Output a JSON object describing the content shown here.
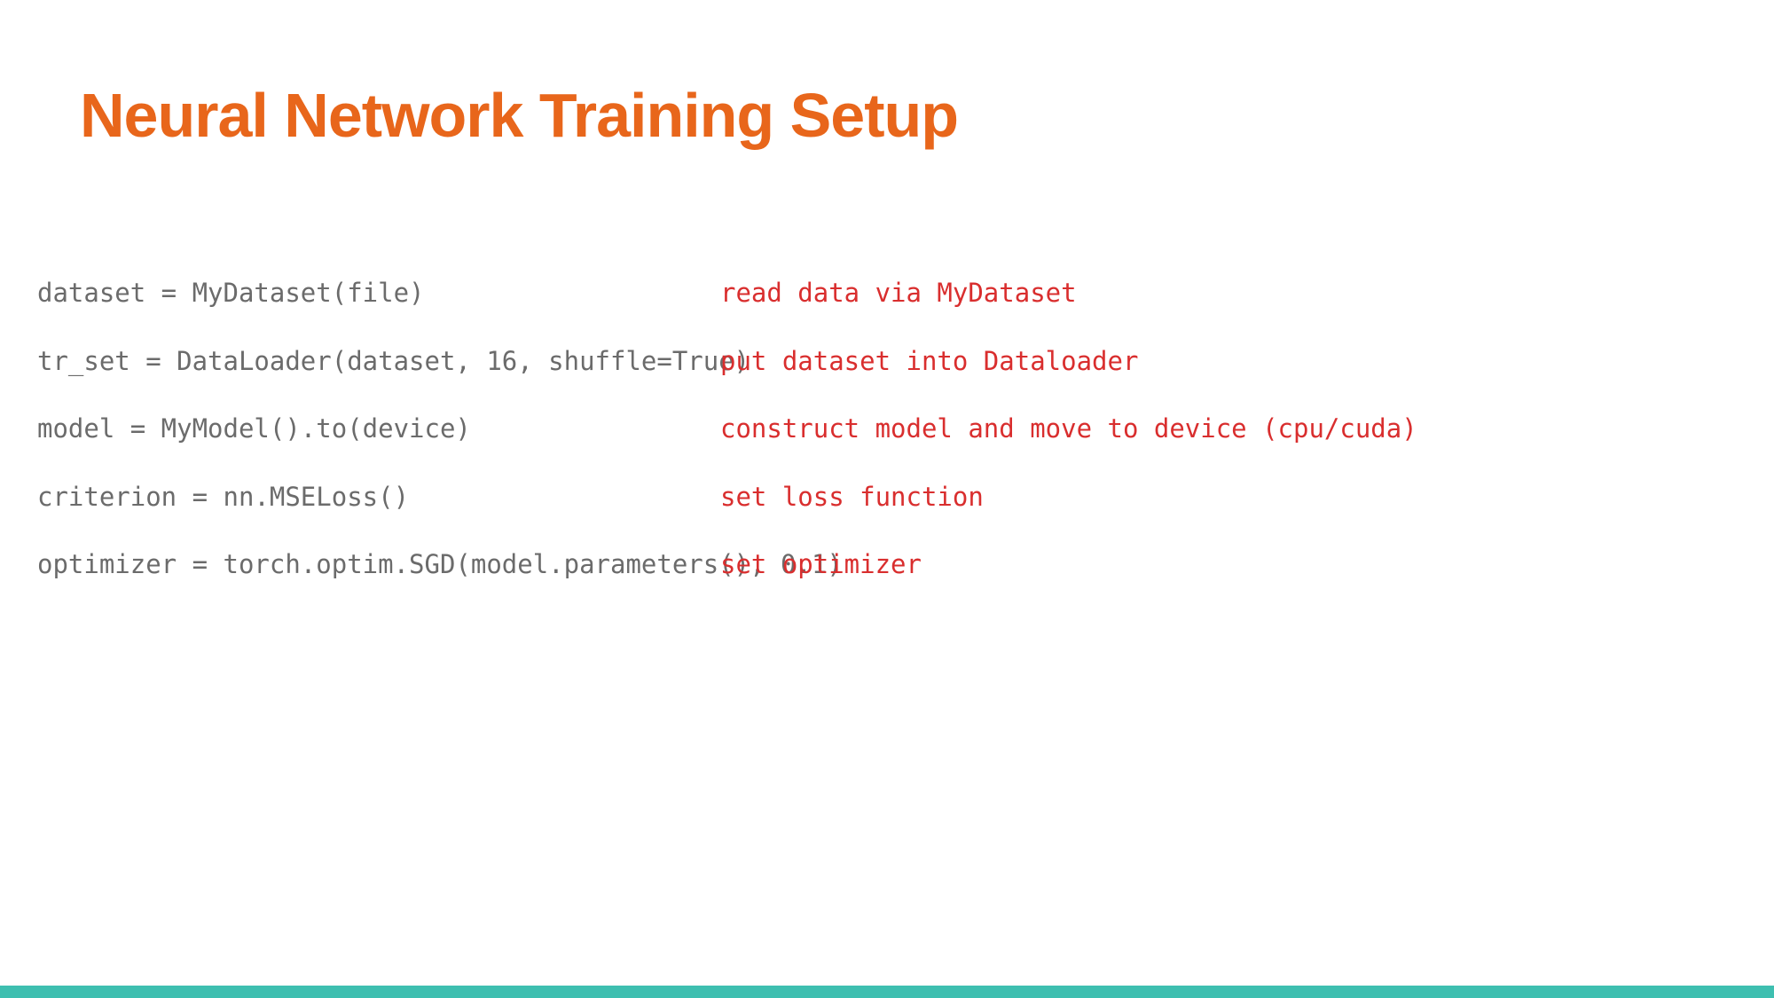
{
  "title": "Neural Network Training Setup",
  "rows": [
    {
      "code": "dataset = MyDataset(file)",
      "comment": "read data via MyDataset"
    },
    {
      "code": "tr_set = DataLoader(dataset, 16, shuffle=True)",
      "comment": "put dataset into Dataloader"
    },
    {
      "code": "model = MyModel().to(device)",
      "comment": "construct model and move to device (cpu/cuda)"
    },
    {
      "code": "criterion = nn.MSELoss()",
      "comment": "set loss function"
    },
    {
      "code": "optimizer = torch.optim.SGD(model.parameters(), 0.1)",
      "comment": "set optimizer"
    }
  ]
}
